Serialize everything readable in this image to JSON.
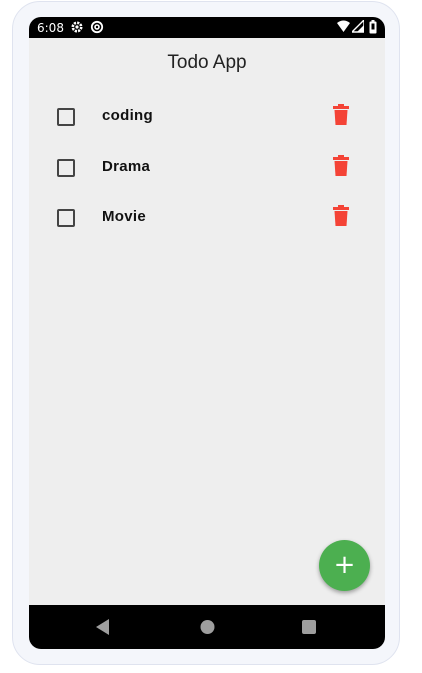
{
  "status_bar": {
    "time": "6:08",
    "left_icons": [
      "gear-icon",
      "at-sign-icon"
    ],
    "right_icons": [
      "wifi-icon",
      "signal-icon",
      "battery-icon"
    ]
  },
  "app": {
    "title": "Todo App"
  },
  "todos": [
    {
      "label": "coding",
      "checked": false
    },
    {
      "label": "Drama",
      "checked": false
    },
    {
      "label": "Movie",
      "checked": false
    }
  ],
  "fab": {
    "label": "+"
  },
  "colors": {
    "delete": "#f44336",
    "fab": "#4caf50",
    "background": "#eeeeee"
  },
  "nav_bar": {
    "buttons": [
      "back-icon",
      "home-icon",
      "recents-icon"
    ]
  }
}
